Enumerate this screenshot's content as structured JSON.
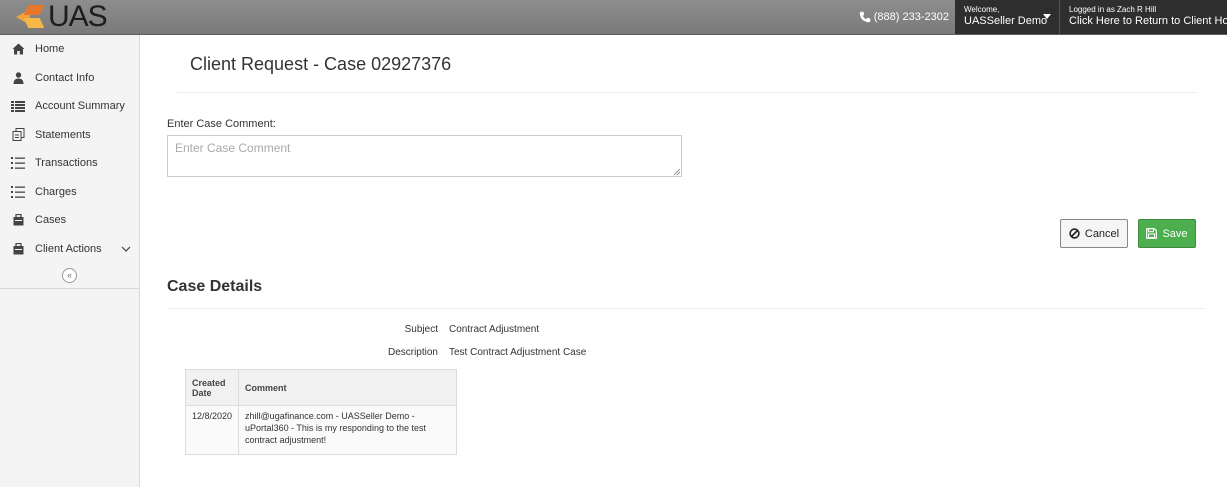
{
  "brand": {
    "logo_text": "UAS"
  },
  "topbar": {
    "phone": "(888) 233-2302",
    "welcome_small": "Welcome,",
    "welcome_name": "UASSeller Demo",
    "logged_small": "Logged in as Zach R Hill",
    "logged_link": "Click Here to Return to Client Home"
  },
  "sidebar": {
    "items": [
      {
        "label": "Home",
        "icon": "home-icon"
      },
      {
        "label": "Contact Info",
        "icon": "user-icon"
      },
      {
        "label": "Account Summary",
        "icon": "list-icon"
      },
      {
        "label": "Statements",
        "icon": "documents-icon"
      },
      {
        "label": "Transactions",
        "icon": "numbered-list-icon"
      },
      {
        "label": "Charges",
        "icon": "numbered-list-icon"
      },
      {
        "label": "Cases",
        "icon": "case-icon"
      },
      {
        "label": "Client Actions",
        "icon": "case-icon"
      }
    ],
    "collapse_glyph": "«"
  },
  "page": {
    "title": "Client Request - Case 02927376",
    "comment_label": "Enter Case Comment:",
    "comment_placeholder": "Enter Case Comment",
    "cancel_label": "Cancel",
    "save_label": "Save"
  },
  "details": {
    "section_title": "Case Details",
    "subject_key": "Subject",
    "subject_val": "Contract Adjustment",
    "description_key": "Description",
    "description_val": "Test Contract Adjustment Case"
  },
  "comments_table": {
    "headers": [
      "Created Date",
      "Comment"
    ],
    "rows": [
      [
        "12/8/2020",
        "zhill@ugafinance.com - UASSeller Demo - uPortal360 - This is my responding to the test contract adjustment!"
      ]
    ]
  },
  "colors": {
    "save": "#4cae4c",
    "topbar": "#7a7a7a",
    "dark_panel": "#2e2e2e",
    "logo_orange": "#e5782a"
  }
}
